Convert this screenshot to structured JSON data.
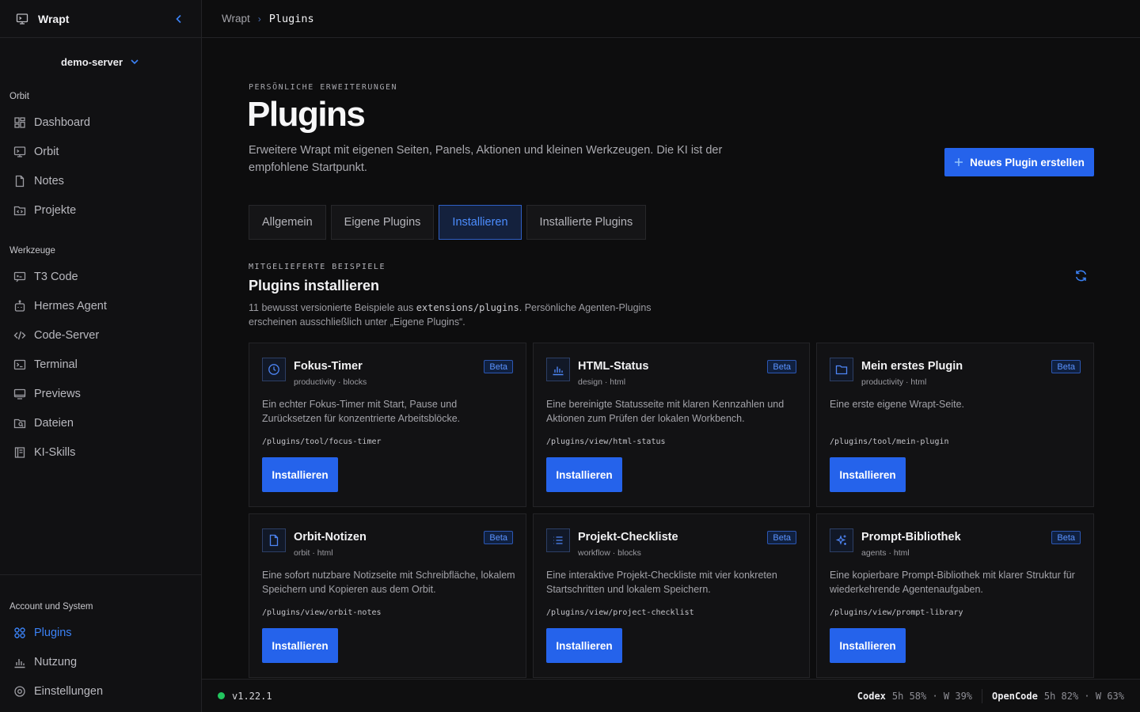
{
  "app": {
    "name": "Wrapt",
    "server": "demo-server"
  },
  "sidebar": {
    "groups": [
      {
        "title": "Orbit",
        "items": [
          {
            "label": "Dashboard",
            "icon": "dashboard-icon"
          },
          {
            "label": "Orbit",
            "icon": "monitor-icon"
          },
          {
            "label": "Notes",
            "icon": "file-icon"
          },
          {
            "label": "Projekte",
            "icon": "folder-code-icon"
          }
        ]
      },
      {
        "title": "Werkzeuge",
        "items": [
          {
            "label": "T3 Code",
            "icon": "chat-code-icon"
          },
          {
            "label": "Hermes Agent",
            "icon": "bot-icon"
          },
          {
            "label": "Code-Server",
            "icon": "code-icon"
          },
          {
            "label": "Terminal",
            "icon": "terminal-icon"
          },
          {
            "label": "Previews",
            "icon": "screen-icon"
          },
          {
            "label": "Dateien",
            "icon": "folder-search-icon"
          },
          {
            "label": "KI-Skills",
            "icon": "book-icon"
          }
        ]
      }
    ],
    "bottom": {
      "title": "Account und System",
      "items": [
        {
          "label": "Plugins",
          "icon": "grid-icon",
          "active": true
        },
        {
          "label": "Nutzung",
          "icon": "bar-chart-icon"
        },
        {
          "label": "Einstellungen",
          "icon": "settings-icon"
        }
      ]
    }
  },
  "breadcrumb": {
    "root": "Wrapt",
    "separator": "›",
    "current": "Plugins"
  },
  "page": {
    "eyebrow": "PERSÖNLICHE ERWEITERUNGEN",
    "title": "Plugins",
    "description": "Erweitere Wrapt mit eigenen Seiten, Panels, Aktionen und kleinen Werkzeugen. Die KI ist der empfohlene Startpunkt.",
    "new_button": "Neues Plugin erstellen"
  },
  "tabs": [
    {
      "label": "Allgemein"
    },
    {
      "label": "Eigene Plugins"
    },
    {
      "label": "Installieren",
      "active": true
    },
    {
      "label": "Installierte Plugins"
    }
  ],
  "section": {
    "eyebrow": "MITGELIEFERTE BEISPIELE",
    "title": "Plugins installieren",
    "desc_before": "11 bewusst versionierte Beispiele aus ",
    "desc_code": "extensions/plugins",
    "desc_after": ". Persönliche Agenten-Plugins erscheinen ausschließlich unter „Eigene Plugins“."
  },
  "cards": [
    {
      "title": "Fokus-Timer",
      "meta": "productivity · blocks",
      "badge": "Beta",
      "icon": "clock-icon",
      "desc": "Ein echter Fokus-Timer mit Start, Pause und Zurücksetzen für konzentrierte Arbeitsblöcke.",
      "path": "/plugins/tool/focus-timer",
      "button": "Installieren"
    },
    {
      "title": "HTML-Status",
      "meta": "design · html",
      "badge": "Beta",
      "icon": "bar-chart-icon",
      "desc": "Eine bereinigte Statusseite mit klaren Kennzahlen und Aktionen zum Prüfen der lokalen Workbench.",
      "path": "/plugins/view/html-status",
      "button": "Installieren"
    },
    {
      "title": "Mein erstes Plugin",
      "meta": "productivity · html",
      "badge": "Beta",
      "icon": "folder-icon",
      "desc": "Eine erste eigene Wrapt-Seite.",
      "path": "/plugins/tool/mein-plugin",
      "button": "Installieren"
    },
    {
      "title": "Orbit-Notizen",
      "meta": "orbit · html",
      "badge": "Beta",
      "icon": "file-icon",
      "desc": "Eine sofort nutzbare Notizseite mit Schreibfläche, lokalem Speichern und Kopieren aus dem Orbit.",
      "path": "/plugins/view/orbit-notes",
      "button": "Installieren"
    },
    {
      "title": "Projekt-Checkliste",
      "meta": "workflow · blocks",
      "badge": "Beta",
      "icon": "list-icon",
      "desc": "Eine interaktive Projekt-Checkliste mit vier konkreten Startschritten und lokalem Speichern.",
      "path": "/plugins/view/project-checklist",
      "button": "Installieren"
    },
    {
      "title": "Prompt-Bibliothek",
      "meta": "agents · html",
      "badge": "Beta",
      "icon": "sparkles-icon",
      "desc": "Eine kopierbare Prompt-Bibliothek mit klarer Struktur für wiederkehrende Agentenaufgaben.",
      "path": "/plugins/view/prompt-library",
      "button": "Installieren"
    }
  ],
  "status": {
    "version": "v1.22.1",
    "codex": {
      "label": "Codex",
      "value": "5h 58% · W 39%"
    },
    "opencode": {
      "label": "OpenCode",
      "value": "5h 82% · W 63%"
    }
  }
}
